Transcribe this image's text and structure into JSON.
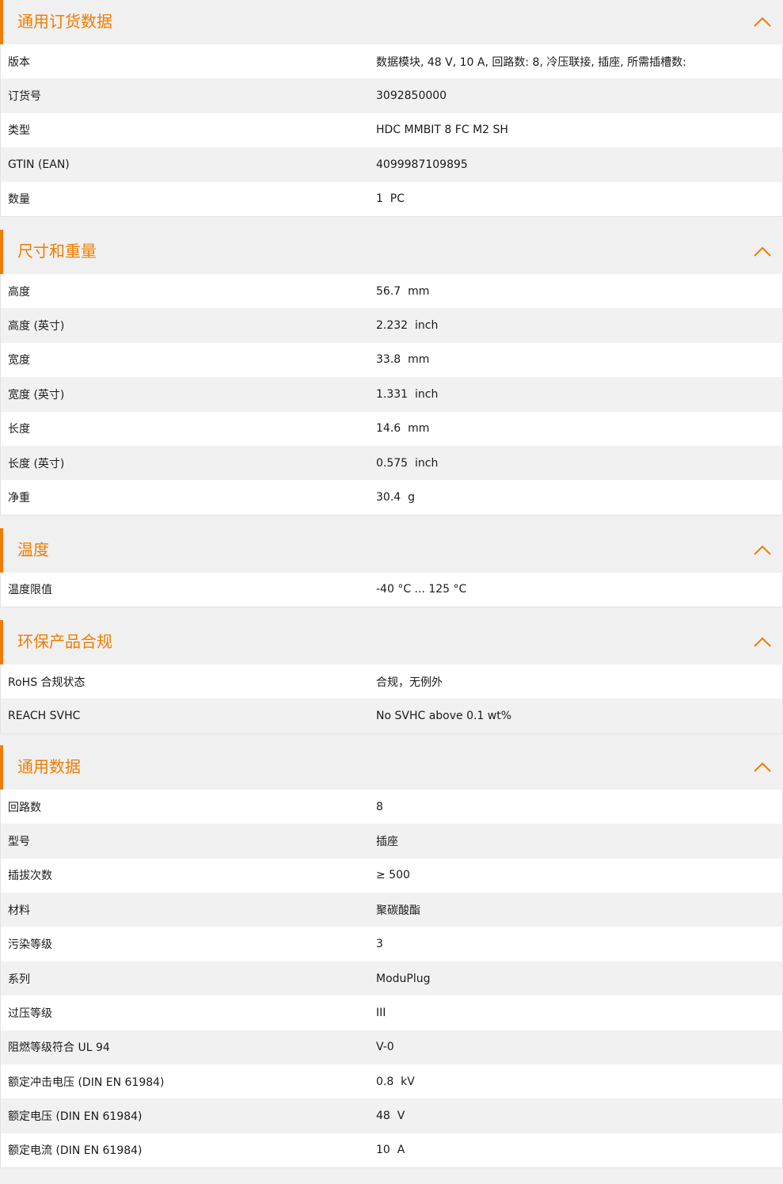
{
  "accent_color": "#f07d00",
  "sections": [
    {
      "title": "通用订货数据",
      "rows": [
        {
          "label": "版本",
          "value": "数据模块, 48 V, 10 A, 回路数: 8, 冷压联接, 插座, 所需插槽数:"
        },
        {
          "label": "订货号",
          "value": "3092850000"
        },
        {
          "label": "类型",
          "value": "HDC MMBIT 8 FC M2 SH"
        },
        {
          "label": "GTIN (EAN)",
          "value": "4099987109895"
        },
        {
          "label": "数量",
          "value": "1  PC"
        }
      ]
    },
    {
      "title": "尺寸和重量",
      "rows": [
        {
          "label": "高度",
          "value": "56.7  mm"
        },
        {
          "label": "高度 (英寸)",
          "value": "2.232  inch"
        },
        {
          "label": "宽度",
          "value": "33.8  mm"
        },
        {
          "label": "宽度 (英寸)",
          "value": "1.331  inch"
        },
        {
          "label": "长度",
          "value": "14.6  mm"
        },
        {
          "label": "长度 (英寸)",
          "value": "0.575  inch"
        },
        {
          "label": "净重",
          "value": "30.4  g"
        }
      ]
    },
    {
      "title": "温度",
      "rows": [
        {
          "label": "温度限值",
          "value": "-40 °C ... 125 °C"
        }
      ]
    },
    {
      "title": "环保产品合规",
      "rows": [
        {
          "label": "RoHS 合规状态",
          "value": "合规，无例外"
        },
        {
          "label": "REACH SVHC",
          "value": "No SVHC above 0.1 wt%"
        }
      ]
    },
    {
      "title": "通用数据",
      "rows": [
        {
          "label": "回路数",
          "value": "8"
        },
        {
          "label": "型号",
          "value": "插座"
        },
        {
          "label": "插拔次数",
          "value": "≥ 500"
        },
        {
          "label": "材料",
          "value": "聚碳酸酯"
        },
        {
          "label": "污染等级",
          "value": "3"
        },
        {
          "label": "系列",
          "value": "ModuPlug"
        },
        {
          "label": "过压等级",
          "value": "III"
        },
        {
          "label": "阻燃等级符合 UL 94",
          "value": "V-0"
        },
        {
          "label": "额定冲击电压 (DIN EN 61984)",
          "value": "0.8  kV"
        },
        {
          "label": "额定电压 (DIN EN 61984)",
          "value": "48  V"
        },
        {
          "label": "额定电流 (DIN EN 61984)",
          "value": "10  A"
        }
      ]
    }
  ]
}
